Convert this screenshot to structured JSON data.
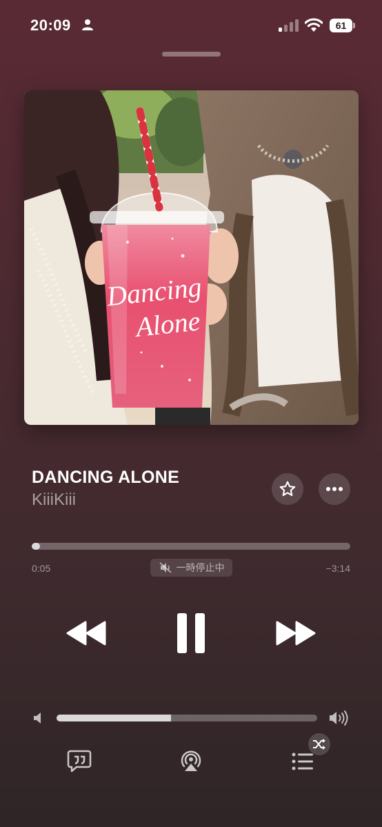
{
  "status_bar": {
    "time": "20:09",
    "battery": "61",
    "icons": [
      "person-icon",
      "signal-icon",
      "wifi-icon",
      "battery-icon"
    ]
  },
  "artwork": {
    "cup_text_line1": "Dancing",
    "cup_text_line2": "Alone"
  },
  "track": {
    "title": "DANCING ALONE",
    "artist": "KiiiKiii"
  },
  "playback": {
    "elapsed": "0:05",
    "remaining": "−3:14",
    "progress_fraction": 0.026,
    "status_label": "一時停止中",
    "state": "playing"
  },
  "volume": {
    "level_fraction": 0.44
  },
  "icons": {
    "favorite": "star-icon",
    "more": "ellipsis-icon",
    "rewind": "rewind-icon",
    "pause": "pause-icon",
    "forward": "fast-forward-icon",
    "lyrics": "lyrics-icon",
    "airplay": "airplay-icon",
    "queue": "queue-icon",
    "shuffle": "shuffle-icon"
  },
  "colors": {
    "background_top": "#5a2a34",
    "background_bottom": "#2f2526",
    "drink": "#e84e72"
  }
}
